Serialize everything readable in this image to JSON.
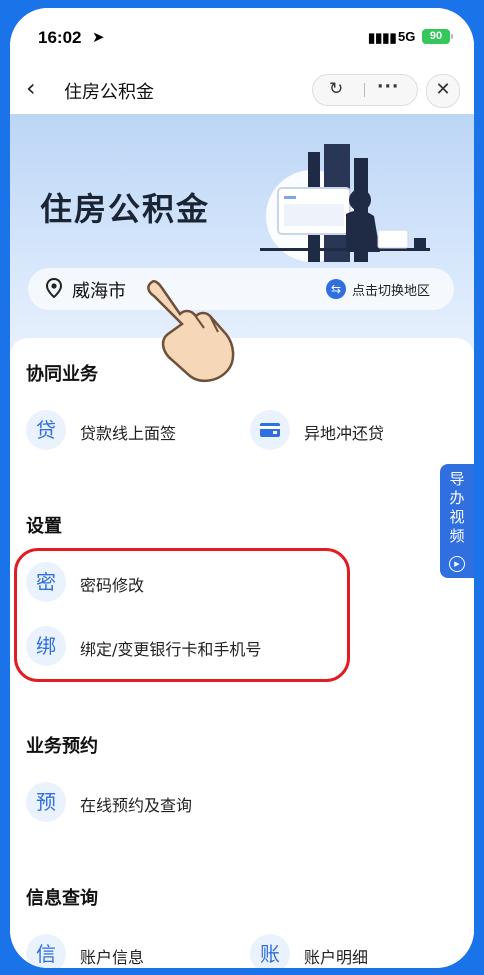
{
  "status_bar": {
    "time": "16:02",
    "network": "5G",
    "battery": "90"
  },
  "nav": {
    "title": "住房公积金",
    "back_icon": "‹",
    "refresh_icon": "↻",
    "more_icon": "···",
    "close_icon": "✕"
  },
  "banner": {
    "title": "住房公积金",
    "city": "威海市",
    "switch_label": "点击切换地区"
  },
  "sections": {
    "cooperate": {
      "title": "协同业务",
      "items": [
        {
          "icon": "贷",
          "label": "贷款线上面签"
        },
        {
          "icon": "card-icon",
          "label": "异地冲还贷"
        }
      ]
    },
    "settings": {
      "title": "设置",
      "items": [
        {
          "icon": "密",
          "label": "密码修改"
        },
        {
          "icon": "绑",
          "label": "绑定/变更银行卡和手机号"
        }
      ]
    },
    "appointment": {
      "title": "业务预约",
      "items": [
        {
          "icon": "预",
          "label": "在线预约及查询"
        }
      ]
    },
    "query": {
      "title": "信息查询",
      "items": [
        {
          "icon": "信",
          "label": "账户信息"
        },
        {
          "icon": "账",
          "label": "账户明细"
        }
      ]
    }
  },
  "guide": {
    "label": "导办视频"
  },
  "colors": {
    "accent": "#2f6fe0",
    "highlight": "#e31b23",
    "frame": "#1a73e8"
  }
}
